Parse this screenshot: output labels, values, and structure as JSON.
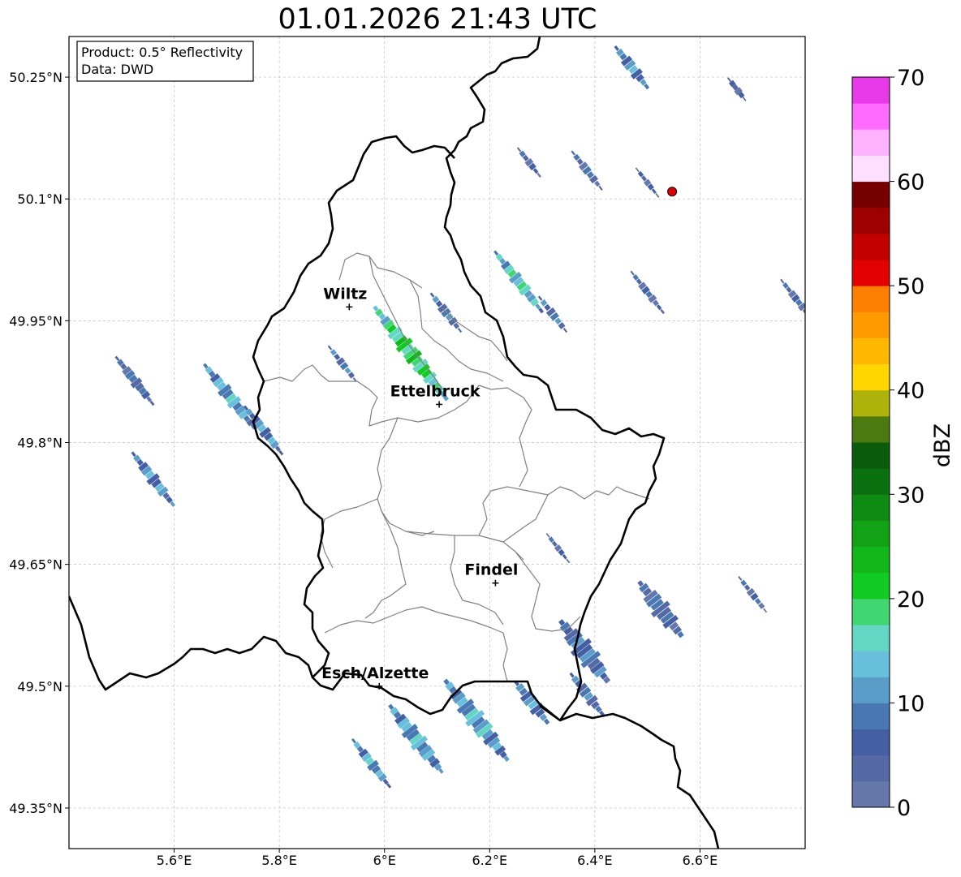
{
  "title": "01.01.2026 21:43 UTC",
  "info": {
    "product": "Product: 0.5° Reflectivity",
    "data": "Data: DWD"
  },
  "map": {
    "lon_range": [
      5.4,
      6.8
    ],
    "lat_range": [
      49.3,
      50.3
    ],
    "lon_ticks": [
      "5.6°E",
      "5.8°E",
      "6°E",
      "6.2°E",
      "6.4°E",
      "6.6°E"
    ],
    "lat_ticks": [
      "50.25°N",
      "50.1°N",
      "49.95°N",
      "49.8°N",
      "49.65°N",
      "49.5°N",
      "49.35°N"
    ],
    "grid": true,
    "radar_site_marker": {
      "lon": 6.547,
      "lat": 50.109,
      "color": "#e00000"
    }
  },
  "cities": [
    {
      "name": "Wiltz",
      "lon": 5.933,
      "lat": 49.967
    },
    {
      "name": "Ettelbruck",
      "lon": 6.104,
      "lat": 49.847
    },
    {
      "name": "Findel",
      "lon": 6.211,
      "lat": 49.627
    },
    {
      "name": "Esch/Alzette",
      "lon": 5.99,
      "lat": 49.5
    }
  ],
  "colorbar": {
    "label": "dBZ",
    "min": 0,
    "max": 70,
    "step": 2.5,
    "tick_labels": [
      "0",
      "10",
      "20",
      "30",
      "40",
      "50",
      "60",
      "70"
    ],
    "colors": [
      "#6577ab",
      "#5569a5",
      "#445fa4",
      "#4a78b2",
      "#5a9dc8",
      "#69c0dd",
      "#63d6c4",
      "#40d672",
      "#11ca22",
      "#12b81a",
      "#11a315",
      "#0f8b13",
      "#0b7110",
      "#0a5b0c",
      "#4a7a10",
      "#aeb30a",
      "#ffd600",
      "#ffb800",
      "#ff9a00",
      "#ff7f00",
      "#e30000",
      "#c30000",
      "#9e0000",
      "#760000",
      "#ffdfff",
      "#ffb3ff",
      "#ff6cff",
      "#e83ae8"
    ]
  },
  "echoes": [
    {
      "name": "echo-sw-1",
      "lon": 5.525,
      "lat": 49.876,
      "len": 0.07,
      "wid": 0.022,
      "dbz": 6
    },
    {
      "name": "echo-sw-2",
      "lon": 5.56,
      "lat": 49.755,
      "len": 0.078,
      "wid": 0.025,
      "dbz": 10
    },
    {
      "name": "echo-w-1",
      "lon": 5.705,
      "lat": 49.857,
      "len": 0.095,
      "wid": 0.028,
      "dbz": 12
    },
    {
      "name": "echo-w-2",
      "lon": 5.77,
      "lat": 49.815,
      "len": 0.07,
      "wid": 0.022,
      "dbz": 10
    },
    {
      "name": "echo-w-3",
      "lon": 5.92,
      "lat": 49.897,
      "len": 0.05,
      "wid": 0.016,
      "dbz": 8
    },
    {
      "name": "echo-c-1",
      "lon": 6.05,
      "lat": 49.91,
      "len": 0.14,
      "wid": 0.035,
      "dbz": 20
    },
    {
      "name": "echo-c-2",
      "lon": 6.117,
      "lat": 49.96,
      "len": 0.055,
      "wid": 0.02,
      "dbz": 8
    },
    {
      "name": "echo-n-1",
      "lon": 6.255,
      "lat": 49.998,
      "len": 0.09,
      "wid": 0.025,
      "dbz": 15
    },
    {
      "name": "echo-n-2",
      "lon": 6.32,
      "lat": 49.958,
      "len": 0.05,
      "wid": 0.018,
      "dbz": 8
    },
    {
      "name": "echo-n-3",
      "lon": 6.47,
      "lat": 50.262,
      "len": 0.06,
      "wid": 0.025,
      "dbz": 10
    },
    {
      "name": "echo-n-4",
      "lon": 6.385,
      "lat": 50.135,
      "len": 0.055,
      "wid": 0.018,
      "dbz": 6
    },
    {
      "name": "echo-n-5",
      "lon": 6.5,
      "lat": 50.12,
      "len": 0.04,
      "wid": 0.012,
      "dbz": 4
    },
    {
      "name": "echo-n-6",
      "lon": 6.275,
      "lat": 50.145,
      "len": 0.04,
      "wid": 0.015,
      "dbz": 5
    },
    {
      "name": "echo-n-7",
      "lon": 6.67,
      "lat": 50.235,
      "len": 0.03,
      "wid": 0.015,
      "dbz": 4
    },
    {
      "name": "echo-e-1",
      "lon": 6.5,
      "lat": 49.985,
      "len": 0.06,
      "wid": 0.016,
      "dbz": 5
    },
    {
      "name": "echo-e-2",
      "lon": 6.785,
      "lat": 49.975,
      "len": 0.06,
      "wid": 0.016,
      "dbz": 5
    },
    {
      "name": "echo-e-3",
      "lon": 6.38,
      "lat": 49.543,
      "len": 0.09,
      "wid": 0.045,
      "dbz": 8
    },
    {
      "name": "echo-e-4",
      "lon": 6.525,
      "lat": 49.595,
      "len": 0.08,
      "wid": 0.04,
      "dbz": 6
    },
    {
      "name": "echo-e-5",
      "lon": 6.7,
      "lat": 49.613,
      "len": 0.05,
      "wid": 0.015,
      "dbz": 5
    },
    {
      "name": "echo-e-6",
      "lon": 6.33,
      "lat": 49.67,
      "len": 0.04,
      "wid": 0.012,
      "dbz": 5
    },
    {
      "name": "echo-s-1",
      "lon": 6.175,
      "lat": 49.458,
      "len": 0.12,
      "wid": 0.04,
      "dbz": 12
    },
    {
      "name": "echo-s-2",
      "lon": 6.06,
      "lat": 49.435,
      "len": 0.1,
      "wid": 0.035,
      "dbz": 12
    },
    {
      "name": "echo-s-3",
      "lon": 5.975,
      "lat": 49.405,
      "len": 0.07,
      "wid": 0.022,
      "dbz": 12
    },
    {
      "name": "echo-s-4",
      "lon": 6.28,
      "lat": 49.48,
      "len": 0.06,
      "wid": 0.03,
      "dbz": 10
    },
    {
      "name": "echo-s-5",
      "lon": 6.385,
      "lat": 49.49,
      "len": 0.06,
      "wid": 0.025,
      "dbz": 8
    }
  ]
}
